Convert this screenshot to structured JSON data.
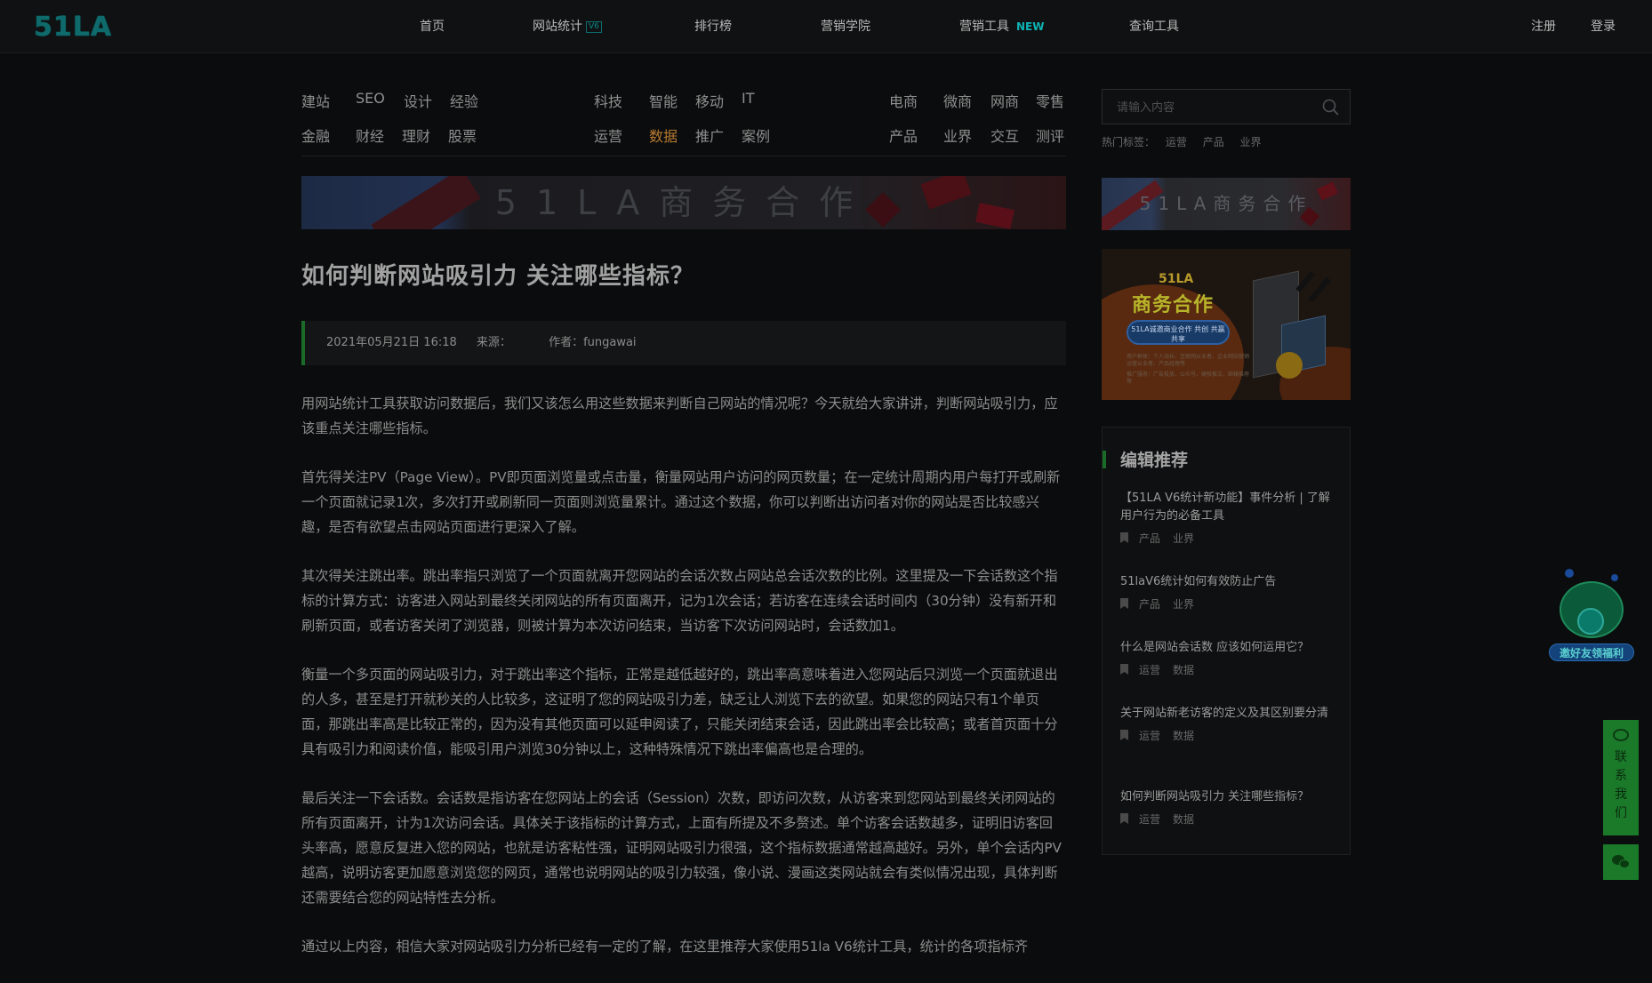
{
  "header": {
    "logo": "51LA",
    "nav": [
      {
        "label": "首页"
      },
      {
        "label": "网站统计",
        "badge": "V6"
      },
      {
        "label": "排行榜"
      },
      {
        "label": "营销学院"
      },
      {
        "label": "营销工具",
        "badge": "NEW"
      },
      {
        "label": "查询工具"
      }
    ],
    "register": "注册",
    "login": "登录"
  },
  "categories": [
    "建站",
    "SEO",
    "设计",
    "经验",
    "科技",
    "智能",
    "移动",
    "IT",
    "电商",
    "微商",
    "网商",
    "零售",
    "金融",
    "财经",
    "理财",
    "股票",
    "运营",
    "数据",
    "推广",
    "案例",
    "产品",
    "业界",
    "交互",
    "测评"
  ],
  "active_category": "数据",
  "banner_text": "51LA商务合作",
  "article": {
    "title": "如何判断网站吸引力 关注哪些指标？",
    "date": "2021年05月21日 16:18",
    "source": "来源：",
    "author": "作者：fungawai",
    "paragraphs": [
      "用网站统计工具获取访问数据后，我们又该怎么用这些数据来判断自己网站的情况呢？今天就给大家讲讲，判断网站吸引力，应该重点关注哪些指标。",
      "首先得关注PV（Page View）。PV即页面浏览量或点击量，衡量网站用户访问的网页数量；在一定统计周期内用户每打开或刷新一个页面就记录1次，多次打开或刷新同一页面则浏览量累计。通过这个数据，你可以判断出访问者对你的网站是否比较感兴趣，是否有欲望点击网站页面进行更深入了解。",
      "其次得关注跳出率。跳出率指只浏览了一个页面就离开您网站的会话次数占网站总会话次数的比例。这里提及一下会话数这个指标的计算方式：访客进入网站到最终关闭网站的所有页面离开，记为1次会话；若访客在连续会话时间内（30分钟）没有新开和刷新页面，或者访客关闭了浏览器，则被计算为本次访问结束，当访客下次访问网站时，会话数加1。",
      "衡量一个多页面的网站吸引力，对于跳出率这个指标，正常是越低越好的，跳出率高意味着进入您网站后只浏览一个页面就退出的人多，甚至是打开就秒关的人比较多，这证明了您的网站吸引力差，缺乏让人浏览下去的欲望。如果您的网站只有1个单页面，那跳出率高是比较正常的，因为没有其他页面可以延申阅读了，只能关闭结束会话，因此跳出率会比较高；或者首页面十分具有吸引力和阅读价值，能吸引用户浏览30分钟以上，这种特殊情况下跳出率偏高也是合理的。",
      "最后关注一下会话数。会话数是指访客在您网站上的会话（Session）次数，即访问次数，从访客来到您网站到最终关闭网站的所有页面离开，计为1次访问会话。具体关于该指标的计算方式，上面有所提及不多赘述。单个访客会话数越多，证明旧访客回头率高，愿意反复进入您的网站，也就是访客粘性强，证明网站吸引力很强，这个指标数据通常越高越好。另外，单个会话内PV越高，说明访客更加愿意浏览您的网页，通常也说明网站的吸引力较强，像小说、漫画这类网站就会有类似情况出现，具体判断还需要结合您的网站特性去分析。",
      "通过以上内容，相信大家对网站吸引力分析已经有一定的了解，在这里推荐大家使用51la V6统计工具，统计的各项指标齐"
    ]
  },
  "sidebar": {
    "search_placeholder": "请输入内容",
    "hot_label": "热门标签：",
    "hot_tags": [
      "运营",
      "产品",
      "业界"
    ],
    "banner1_text": "51LA商务合作",
    "banner2": {
      "brand": "51LA",
      "title": "商务合作",
      "pill": "51LA诚邀商业合作 共创 共赢 共享",
      "line1": "用户群体：个人站长、互联网从业者、企业网站营销运营从业者、产品经理等",
      "line2": "推广服务：广告投放、公众号、硬核推文、邮箱推荐等"
    },
    "recommend": {
      "title": "编辑推荐",
      "items": [
        {
          "title": "【51LA V6统计新功能】事件分析 | 了解用户行为的必备工具",
          "tags": [
            "产品",
            "业界"
          ]
        },
        {
          "title": "51laV6统计如何有效防止广告",
          "tags": [
            "产品",
            "业界"
          ]
        },
        {
          "title": "什么是网站会话数 应该如何运用它？",
          "tags": [
            "运营",
            "数据"
          ]
        },
        {
          "title": "关于网站新老访客的定义及其区别要分清",
          "tags": [
            "运营",
            "数据"
          ]
        },
        {
          "title": "如何判断网站吸引力 关注哪些指标？",
          "tags": [
            "运营",
            "数据"
          ]
        }
      ]
    }
  },
  "floating": {
    "mascot_label": "邀好友领福利",
    "contact_label": "联系我们"
  }
}
